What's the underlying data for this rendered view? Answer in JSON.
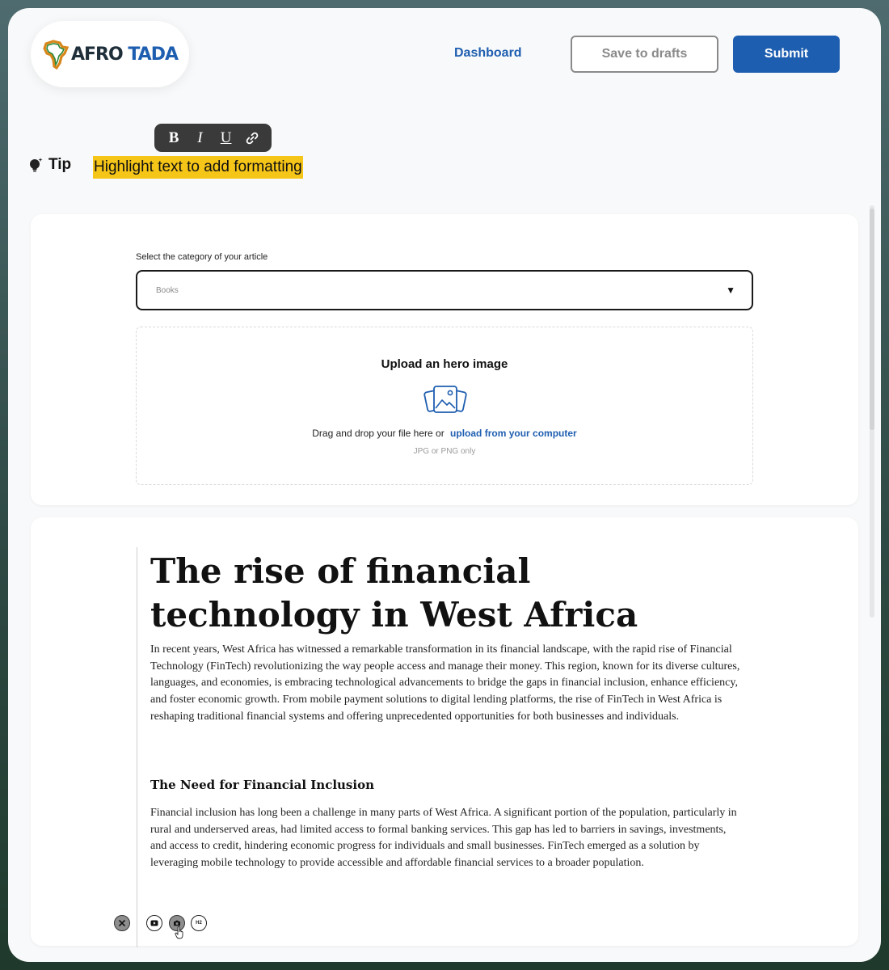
{
  "brand": {
    "logo_text_part1": "AFRO",
    "logo_text_part2": "TADA"
  },
  "header": {
    "dashboard_label": "Dashboard",
    "save_drafts_label": "Save to drafts",
    "submit_label": "Submit"
  },
  "format_toolbar": {
    "bold": "B",
    "italic": "I",
    "underline": "U"
  },
  "tip": {
    "label": "Tip",
    "text": "Highlight text to add formatting"
  },
  "category": {
    "label": "Select the category of your article",
    "value": "Books",
    "caret": "▼"
  },
  "upload": {
    "title": "Upload an hero image",
    "instruction": "Drag and drop your file here or",
    "link": "upload from your computer",
    "hint": "JPG or PNG only"
  },
  "article": {
    "title": "The rise of financial technology in West Africa",
    "intro": "In recent years, West Africa has witnessed a remarkable transformation in its financial landscape, with the rapid rise of Financial Technology (FinTech) revolutionizing the way people access and manage their money. This region, known for its diverse cultures, languages, and economies, is embracing technological advancements to bridge the gaps in financial inclusion, enhance efficiency, and foster economic growth. From mobile payment solutions to digital lending platforms, the rise of FinTech in West Africa is reshaping traditional financial systems and offering unprecedented opportunities for both businesses and individuals.",
    "heading": "The Need for Financial Inclusion",
    "body": "Financial inclusion has long been a challenge in many parts of West Africa. A significant portion of the population, particularly in rural and underserved areas, had limited access to formal banking services. This gap has led to barriers in savings, investments, and access to credit, hindering economic progress for individuals and small businesses. FinTech emerged as a solution by leveraging mobile technology to provide accessible and affordable financial services to a broader population."
  },
  "insert_toolbar": {
    "h2_label": "H2",
    "icons": [
      "close-icon",
      "video-icon",
      "camera-icon"
    ]
  },
  "colors": {
    "brand_blue": "#1e5eb0",
    "highlight_yellow": "#f5c518",
    "toolbar_dark": "#3a3a3a"
  }
}
